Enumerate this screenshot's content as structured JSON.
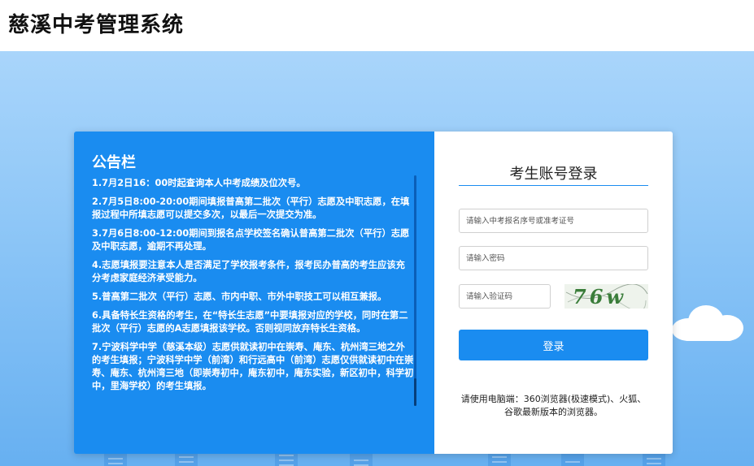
{
  "header": {
    "title": "慈溪中考管理系统"
  },
  "notice": {
    "title": "公告栏",
    "items": [
      "1.7月2日16：00时起查询本人中考成绩及位次号。",
      "2.7月5日8:00-20:00期间填报普高第二批次（平行）志愿及中职志愿，在填报过程中所填志愿可以提交多次，以最后一次提交为准。",
      "3.7月6日8:00-12:00期间到报名点学校签名确认普高第二批次（平行）志愿及中职志愿，逾期不再处理。",
      "4.志愿填报要注意本人是否满足了学校报考条件，报考民办普高的考生应该充分考虑家庭经济承受能力。",
      "5.普高第二批次（平行）志愿、市内中职、市外中职技工可以相互兼报。",
      "6.具备特长生资格的考生，在“特长生志愿”中要填报对应的学校，同时在第二批次（平行）志愿的A志愿填报该学校。否则视同放弃特长生资格。",
      "7.宁波科学中学（慈溪本级）志愿供就读初中在崇寿、庵东、杭州湾三地之外的考生填报；宁波科学中学（前湾）和行远高中（前湾）志愿仅供就读初中在崇寿、庵东、杭州湾三地（即崇寿初中，庵东初中，庵东实验，新区初中，科学初中，里海学校）的考生填报。"
    ]
  },
  "login": {
    "title": "考生账号登录",
    "exam_placeholder": "请输入中考报名序号或准考证号",
    "password_placeholder": "请输入密码",
    "captcha_placeholder": "请输入验证码",
    "captcha_text": "76w",
    "button_label": "登录",
    "browser_tip": "请使用电脑端：360浏览器(极速模式)、火狐、谷歌最新版本的浏览器。"
  },
  "colors": {
    "accent": "#1a8cf0",
    "sky_top": "#a9d5fb",
    "sky_bottom": "#67b0f1"
  }
}
